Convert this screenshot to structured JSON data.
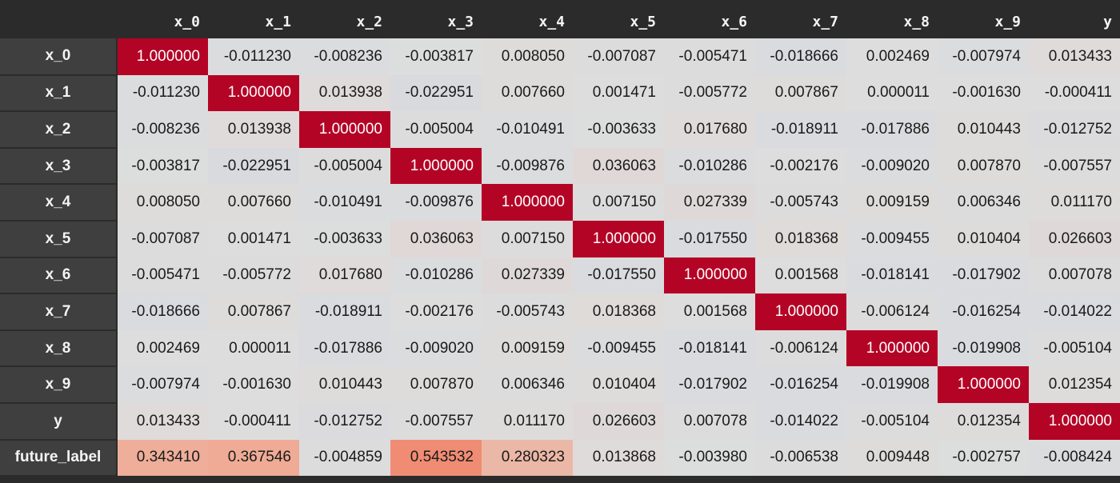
{
  "chart_data": {
    "type": "heatmap",
    "title": "",
    "colormap": "coolwarm",
    "vmin": -1,
    "vmax": 1,
    "colors": {
      "cold": "#3b4cc0",
      "neutral": "#dddddd",
      "warm": "#b40426",
      "header_background": "#2b2b2b",
      "index_background": "#3f3f3f"
    },
    "columns": [
      "x_0",
      "x_1",
      "x_2",
      "x_3",
      "x_4",
      "x_5",
      "x_6",
      "x_7",
      "x_8",
      "x_9",
      "y"
    ],
    "index": [
      "x_0",
      "x_1",
      "x_2",
      "x_3",
      "x_4",
      "x_5",
      "x_6",
      "x_7",
      "x_8",
      "x_9",
      "y",
      "future_label"
    ],
    "values": [
      [
        "1.000000",
        "-0.011230",
        "-0.008236",
        "-0.003817",
        "0.008050",
        "-0.007087",
        "-0.005471",
        "-0.018666",
        "0.002469",
        "-0.007974",
        "0.013433"
      ],
      [
        "-0.011230",
        "1.000000",
        "0.013938",
        "-0.022951",
        "0.007660",
        "0.001471",
        "-0.005772",
        "0.007867",
        "0.000011",
        "-0.001630",
        "-0.000411"
      ],
      [
        "-0.008236",
        "0.013938",
        "1.000000",
        "-0.005004",
        "-0.010491",
        "-0.003633",
        "0.017680",
        "-0.018911",
        "-0.017886",
        "0.010443",
        "-0.012752"
      ],
      [
        "-0.003817",
        "-0.022951",
        "-0.005004",
        "1.000000",
        "-0.009876",
        "0.036063",
        "-0.010286",
        "-0.002176",
        "-0.009020",
        "0.007870",
        "-0.007557"
      ],
      [
        "0.008050",
        "0.007660",
        "-0.010491",
        "-0.009876",
        "1.000000",
        "0.007150",
        "0.027339",
        "-0.005743",
        "0.009159",
        "0.006346",
        "0.011170"
      ],
      [
        "-0.007087",
        "0.001471",
        "-0.003633",
        "0.036063",
        "0.007150",
        "1.000000",
        "-0.017550",
        "0.018368",
        "-0.009455",
        "0.010404",
        "0.026603"
      ],
      [
        "-0.005471",
        "-0.005772",
        "0.017680",
        "-0.010286",
        "0.027339",
        "-0.017550",
        "1.000000",
        "0.001568",
        "-0.018141",
        "-0.017902",
        "0.007078"
      ],
      [
        "-0.018666",
        "0.007867",
        "-0.018911",
        "-0.002176",
        "-0.005743",
        "0.018368",
        "0.001568",
        "1.000000",
        "-0.006124",
        "-0.016254",
        "-0.014022"
      ],
      [
        "0.002469",
        "0.000011",
        "-0.017886",
        "-0.009020",
        "0.009159",
        "-0.009455",
        "-0.018141",
        "-0.006124",
        "1.000000",
        "-0.019908",
        "-0.005104"
      ],
      [
        "-0.007974",
        "-0.001630",
        "0.010443",
        "0.007870",
        "0.006346",
        "0.010404",
        "-0.017902",
        "-0.016254",
        "-0.019908",
        "1.000000",
        "0.012354"
      ],
      [
        "0.013433",
        "-0.000411",
        "-0.012752",
        "-0.007557",
        "0.011170",
        "0.026603",
        "0.007078",
        "-0.014022",
        "-0.005104",
        "0.012354",
        "1.000000"
      ],
      [
        "0.343410",
        "0.367546",
        "-0.004859",
        "0.543532",
        "0.280323",
        "0.013868",
        "-0.003980",
        "-0.006538",
        "0.009448",
        "-0.002757",
        "-0.008424"
      ]
    ]
  }
}
